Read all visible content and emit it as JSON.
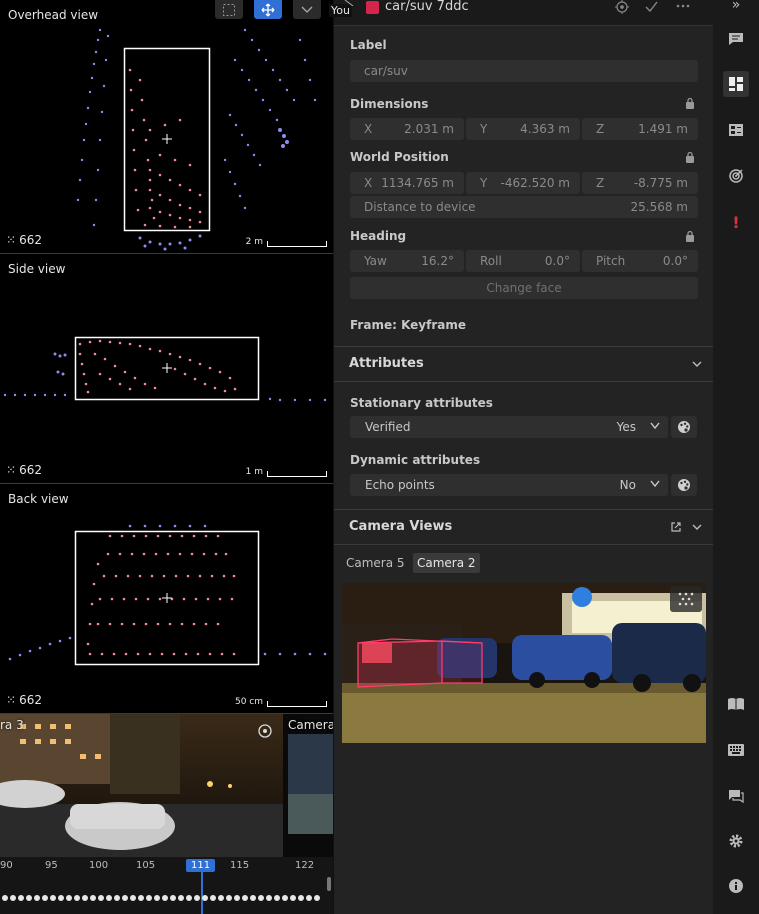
{
  "toolbar": {
    "you_label": "You"
  },
  "views": {
    "overhead": {
      "title": "Overhead view",
      "count": "662",
      "scale": "2 m"
    },
    "side": {
      "title": "Side view",
      "count": "662",
      "scale": "1 m"
    },
    "back": {
      "title": "Back view",
      "count": "662",
      "scale": "50 cm"
    }
  },
  "cameras_strip": {
    "left_label": "ra 3",
    "right_label": "Camera"
  },
  "timeline": {
    "ticks": [
      "90",
      "95",
      "100",
      "105",
      "111",
      "115",
      "122"
    ],
    "selected": "111"
  },
  "object": {
    "title": "car/suv 7ddc",
    "color": "#d6254c"
  },
  "label": {
    "heading": "Label",
    "value": "car/suv"
  },
  "dimensions": {
    "heading": "Dimensions",
    "x_key": "X",
    "x": "2.031 m",
    "y_key": "Y",
    "y": "4.363 m",
    "z_key": "Z",
    "z": "1.491 m"
  },
  "world_position": {
    "heading": "World Position",
    "x_key": "X",
    "x": "1134.765 m",
    "y_key": "Y",
    "y": "-462.520 m",
    "z_key": "Z",
    "z": "-8.775 m",
    "distance_label": "Distance to device",
    "distance": "25.568 m"
  },
  "heading": {
    "heading": "Heading",
    "yaw_key": "Yaw",
    "yaw": "16.2°",
    "roll_key": "Roll",
    "roll": "0.0°",
    "pitch_key": "Pitch",
    "pitch": "0.0°",
    "change_face": "Change face"
  },
  "frame": {
    "label": "Frame: Keyframe"
  },
  "attributes": {
    "heading": "Attributes",
    "stationary_heading": "Stationary attributes",
    "stationary_key": "Verified",
    "stationary_value": "Yes",
    "dynamic_heading": "Dynamic attributes",
    "dynamic_key": "Echo points",
    "dynamic_value": "No"
  },
  "camera_views": {
    "heading": "Camera Views",
    "tabs": [
      "Camera 5",
      "Camera 2"
    ],
    "active_tab": "Camera 2"
  }
}
